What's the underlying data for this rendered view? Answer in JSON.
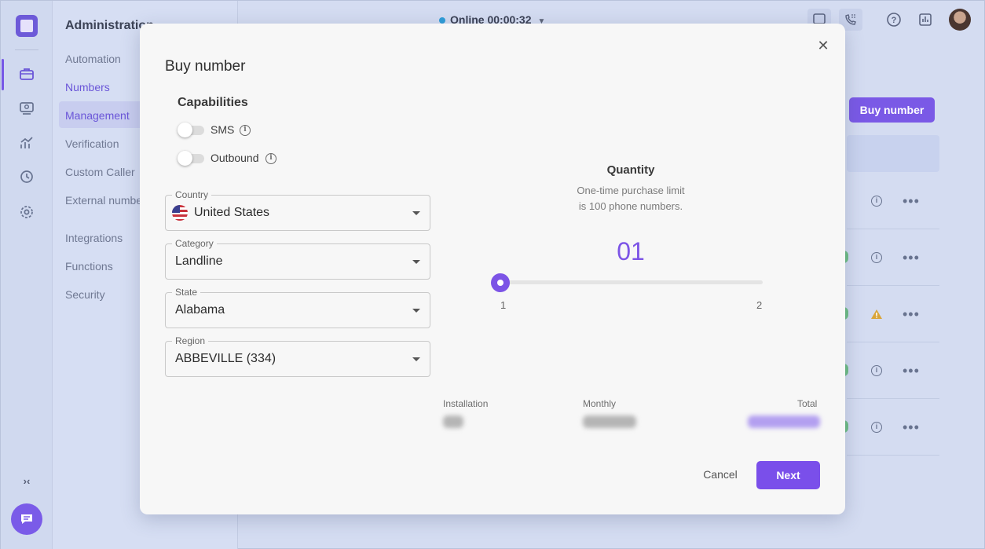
{
  "sidebar": {
    "title": "Administration",
    "items": [
      {
        "label": "Automation"
      },
      {
        "label": "Numbers"
      },
      {
        "label": "Management"
      },
      {
        "label": "Verification"
      },
      {
        "label": "Custom Caller"
      },
      {
        "label": "External numbe"
      },
      {
        "label": "Integrations"
      },
      {
        "label": "Functions"
      },
      {
        "label": "Security"
      }
    ]
  },
  "topbar": {
    "status_label": "Online",
    "timer": "00:00:32"
  },
  "background": {
    "buy_button_label": "Buy number"
  },
  "modal": {
    "title": "Buy number",
    "capabilities_title": "Capabilities",
    "toggles": [
      {
        "label": "SMS",
        "checked": false
      },
      {
        "label": "Outbound",
        "checked": false
      }
    ],
    "fields": {
      "country": {
        "label": "Country",
        "value": "United States"
      },
      "category": {
        "label": "Category",
        "value": "Landline"
      },
      "state": {
        "label": "State",
        "value": "Alabama"
      },
      "region": {
        "label": "Region",
        "value": "ABBEVILLE (334)"
      }
    },
    "quantity": {
      "title": "Quantity",
      "note_line1": "One-time purchase limit",
      "note_line2": "is 100 phone numbers.",
      "value": "01",
      "min": "1",
      "max": "2"
    },
    "pricing": {
      "installation_label": "Installation",
      "monthly_label": "Monthly",
      "total_label": "Total"
    },
    "cancel_label": "Cancel",
    "next_label": "Next"
  },
  "colors": {
    "accent": "#7a4fea",
    "online_dot": "#2e9dd8"
  },
  "icons": {
    "rail": [
      "briefcase-icon",
      "support-icon",
      "analytics-icon",
      "history-icon",
      "settings-icon"
    ],
    "close": "close-icon",
    "info": "info-icon"
  }
}
